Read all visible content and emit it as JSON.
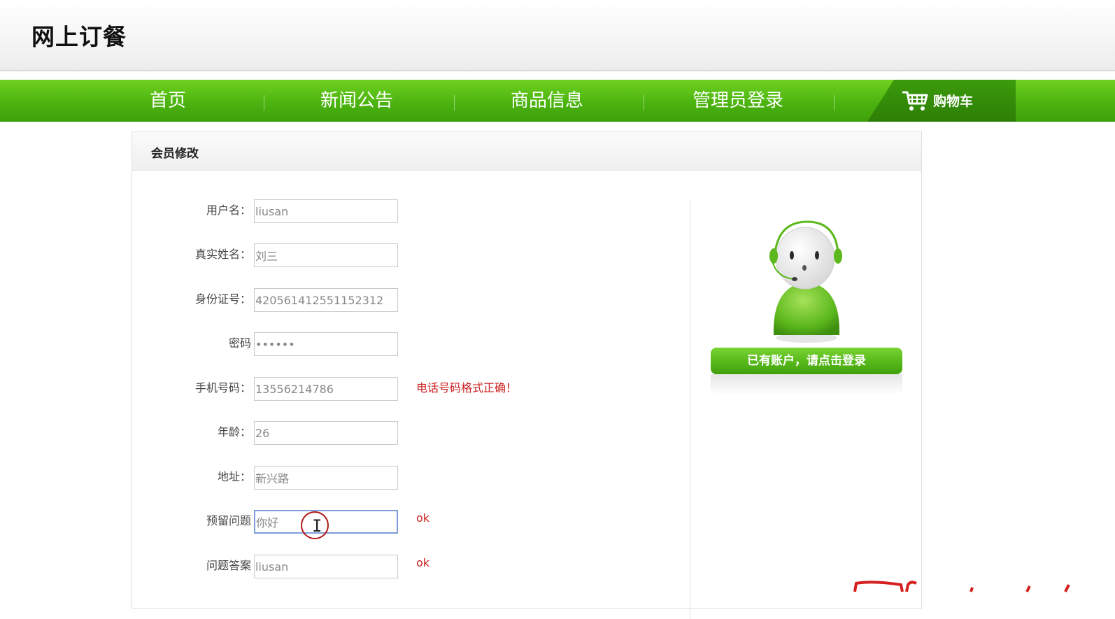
{
  "site": {
    "title": "网上订餐"
  },
  "nav": {
    "items": [
      "首页",
      "新闻公告",
      "商品信息",
      "管理员登录"
    ],
    "cart_label": "购物车"
  },
  "panel": {
    "title": "会员修改"
  },
  "form": {
    "fields": [
      {
        "label": "用户名：",
        "value": "liusan",
        "hint": ""
      },
      {
        "label": "真实姓名：",
        "value": "刘三",
        "hint": ""
      },
      {
        "label": "身份证号：",
        "value": "420561412551152312",
        "hint": ""
      },
      {
        "label": "密码",
        "value": "••••••",
        "hint": ""
      },
      {
        "label": "手机号码：",
        "value": "13556214786",
        "hint": "电话号码格式正确！"
      },
      {
        "label": "年龄：",
        "value": "26",
        "hint": ""
      },
      {
        "label": "地址：",
        "value": "新兴路",
        "hint": ""
      },
      {
        "label": "预留问题",
        "value": "你好",
        "hint": "ok"
      },
      {
        "label": "问题答案",
        "value": "liusan",
        "hint": "ok"
      }
    ]
  },
  "sidebar": {
    "login_button": "已有账户，请点击登录"
  },
  "colors": {
    "nav_green": "#4cb410",
    "cart_dark_green": "#2c7e05",
    "hint_red": "#cc1f1f",
    "focus_border": "#7d9ed9"
  }
}
